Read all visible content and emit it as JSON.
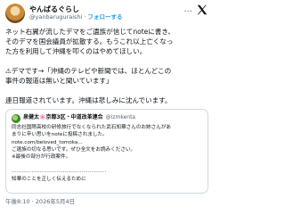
{
  "author": {
    "display_name": "やんばるぐらし",
    "handle": "@yanbaruguraishi",
    "separator": "·",
    "follow_label": "フォローする"
  },
  "more_label": "···",
  "post": {
    "lines": [
      "ネット右翼が流したデマをご遺族が信じてnoteに書き、",
      "そのデマを国会議員が拡散する。もうこれ以上亡くなっ",
      "た方を利用して沖縄を叩くのはやめてほしい。",
      "",
      "⚠デマです→「沖縄のテレビや新聞では、ほとんどこの",
      "事件の報道は無いと聞いています」",
      "",
      "連日報道されています。沖縄は悲しみに沈んでいます。"
    ]
  },
  "quote": {
    "name": "泉健太🌸京都3区・中道改革連合",
    "handle": "@izmkenta",
    "lines": [
      "同志社国際高校の研修旅行でなくなられた武石知華さんのお姉さんがあ",
      "まりに辛い思いをnoteに投稿されました。",
      "note.com/beloved_tomoka...",
      "ご遺族の切なる思いです。ぜひ全文をお読みください。",
      "※最後の部分が行政案件。",
      "",
      "…………………………………………………",
      "知華のことを正しく伝えるために"
    ]
  },
  "timestamp": "午後8:10 · 2026年5月4日"
}
